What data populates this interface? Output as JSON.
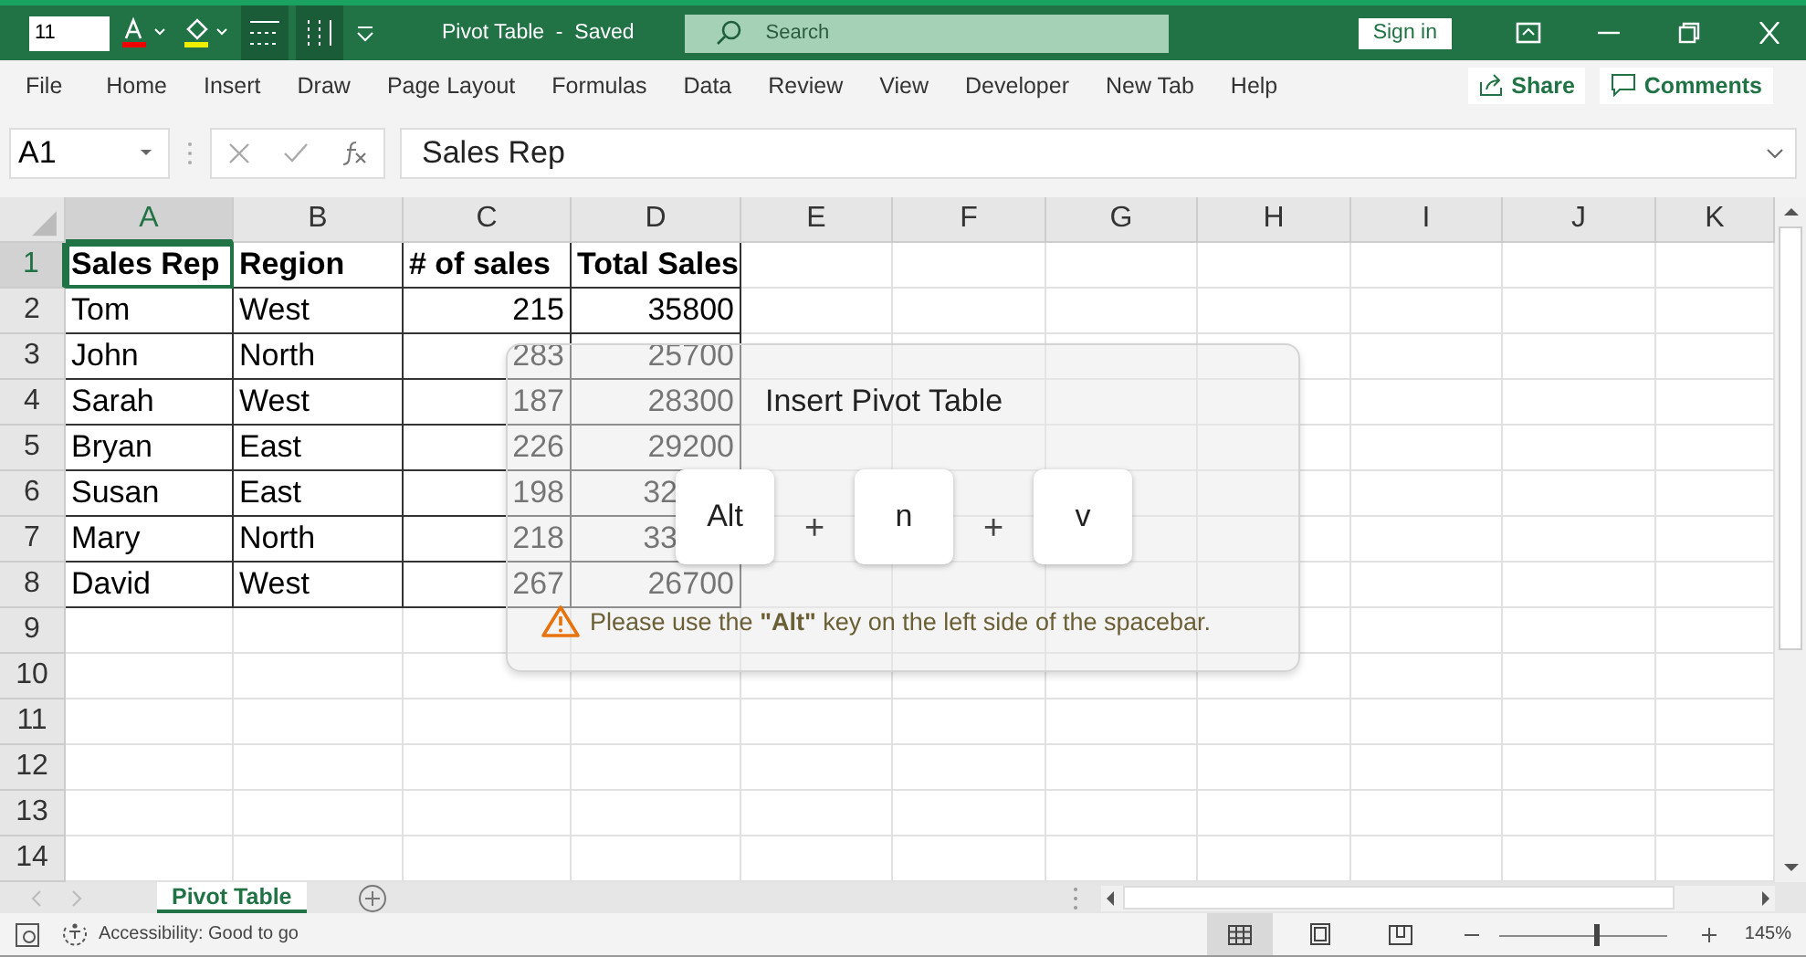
{
  "title_bar": {
    "font_size": "11",
    "title": "Pivot Table  -  Saved",
    "search": {
      "placeholder": "Search"
    },
    "sign_in": "Sign in"
  },
  "menu": {
    "tabs": [
      "File",
      "Home",
      "Insert",
      "Draw",
      "Page Layout",
      "Formulas",
      "Data",
      "Review",
      "View",
      "Developer",
      "New Tab",
      "Help"
    ],
    "share": "Share",
    "comments": "Comments"
  },
  "formula_bar": {
    "name_box": "A1",
    "formula": "Sales Rep"
  },
  "columns": [
    {
      "label": "A",
      "selected": true
    },
    {
      "label": "B",
      "selected": false
    },
    {
      "label": "C",
      "selected": false
    },
    {
      "label": "D",
      "selected": false
    },
    {
      "label": "E",
      "selected": false
    },
    {
      "label": "F",
      "selected": false
    },
    {
      "label": "G",
      "selected": false
    },
    {
      "label": "H",
      "selected": false
    },
    {
      "label": "I",
      "selected": false
    },
    {
      "label": "J",
      "selected": false
    },
    {
      "label": "K",
      "selected": false
    }
  ],
  "rows": [
    {
      "label": "1",
      "selected": true,
      "kind": "header",
      "cells": [
        {
          "value": "Sales Rep",
          "kind": "text",
          "selected": true
        },
        {
          "value": "Region",
          "kind": "text",
          "selected": false
        },
        {
          "value": "# of sales",
          "kind": "text",
          "selected": false
        },
        {
          "value": "Total Sales",
          "kind": "text",
          "selected": false
        }
      ]
    },
    {
      "label": "2",
      "selected": false,
      "kind": "data",
      "cells": [
        {
          "value": "Tom",
          "kind": "text",
          "selected": false
        },
        {
          "value": "West",
          "kind": "text",
          "selected": false
        },
        {
          "value": "215",
          "kind": "number",
          "selected": false
        },
        {
          "value": "35800",
          "kind": "number",
          "selected": false
        }
      ]
    },
    {
      "label": "3",
      "selected": false,
      "kind": "data",
      "cells": [
        {
          "value": "John",
          "kind": "text",
          "selected": false
        },
        {
          "value": "North",
          "kind": "text",
          "selected": false
        },
        {
          "value": "283",
          "kind": "number",
          "selected": false
        },
        {
          "value": "25700",
          "kind": "number",
          "selected": false
        }
      ]
    },
    {
      "label": "4",
      "selected": false,
      "kind": "data",
      "cells": [
        {
          "value": "Sarah",
          "kind": "text",
          "selected": false
        },
        {
          "value": "West",
          "kind": "text",
          "selected": false
        },
        {
          "value": "187",
          "kind": "number",
          "selected": false
        },
        {
          "value": "28300",
          "kind": "number",
          "selected": false
        }
      ]
    },
    {
      "label": "5",
      "selected": false,
      "kind": "data",
      "cells": [
        {
          "value": "Bryan",
          "kind": "text",
          "selected": false
        },
        {
          "value": "East",
          "kind": "text",
          "selected": false
        },
        {
          "value": "226",
          "kind": "number",
          "selected": false
        },
        {
          "value": "29200",
          "kind": "number",
          "selected": false
        }
      ]
    },
    {
      "label": "6",
      "selected": false,
      "kind": "data",
      "cells": [
        {
          "value": "Susan",
          "kind": "text",
          "selected": false
        },
        {
          "value": "East",
          "kind": "text",
          "selected": false
        },
        {
          "value": "198",
          "kind": "number",
          "selected": false
        },
        {
          "value": "32",
          "kind": "cut",
          "selected": false
        }
      ]
    },
    {
      "label": "7",
      "selected": false,
      "kind": "data",
      "cells": [
        {
          "value": "Mary",
          "kind": "text",
          "selected": false
        },
        {
          "value": "North",
          "kind": "text",
          "selected": false
        },
        {
          "value": "218",
          "kind": "number",
          "selected": false
        },
        {
          "value": "33",
          "kind": "cut",
          "selected": false
        }
      ]
    },
    {
      "label": "8",
      "selected": false,
      "kind": "data",
      "cells": [
        {
          "value": "David",
          "kind": "text",
          "selected": false
        },
        {
          "value": "West",
          "kind": "text",
          "selected": false
        },
        {
          "value": "267",
          "kind": "number",
          "selected": false
        },
        {
          "value": "26700",
          "kind": "number",
          "selected": false
        }
      ]
    },
    {
      "label": "9",
      "selected": false,
      "kind": "empty"
    },
    {
      "label": "10",
      "selected": false,
      "kind": "empty"
    },
    {
      "label": "11",
      "selected": false,
      "kind": "empty"
    },
    {
      "label": "12",
      "selected": false,
      "kind": "empty"
    },
    {
      "label": "13",
      "selected": false,
      "kind": "empty"
    },
    {
      "label": "14",
      "selected": false,
      "kind": "empty"
    }
  ],
  "shortcut_popup": {
    "title": "Insert Pivot Table",
    "keys": [
      "Alt",
      "n",
      "v"
    ],
    "separators": [
      "+",
      "+"
    ],
    "warning": "Please use the **\"Alt\"** key on the left side of the spacebar."
  },
  "sheet_tabs": [
    {
      "label": "Pivot Table",
      "selected": true
    }
  ],
  "status_bar": {
    "accessibility": "Accessibility: Good to go",
    "views": [
      {
        "kind": "normal",
        "selected": true
      },
      {
        "kind": "page-layout",
        "selected": false
      },
      {
        "kind": "page-break",
        "selected": false
      }
    ],
    "zoom": {
      "level": 0.57,
      "label": "145%"
    }
  }
}
